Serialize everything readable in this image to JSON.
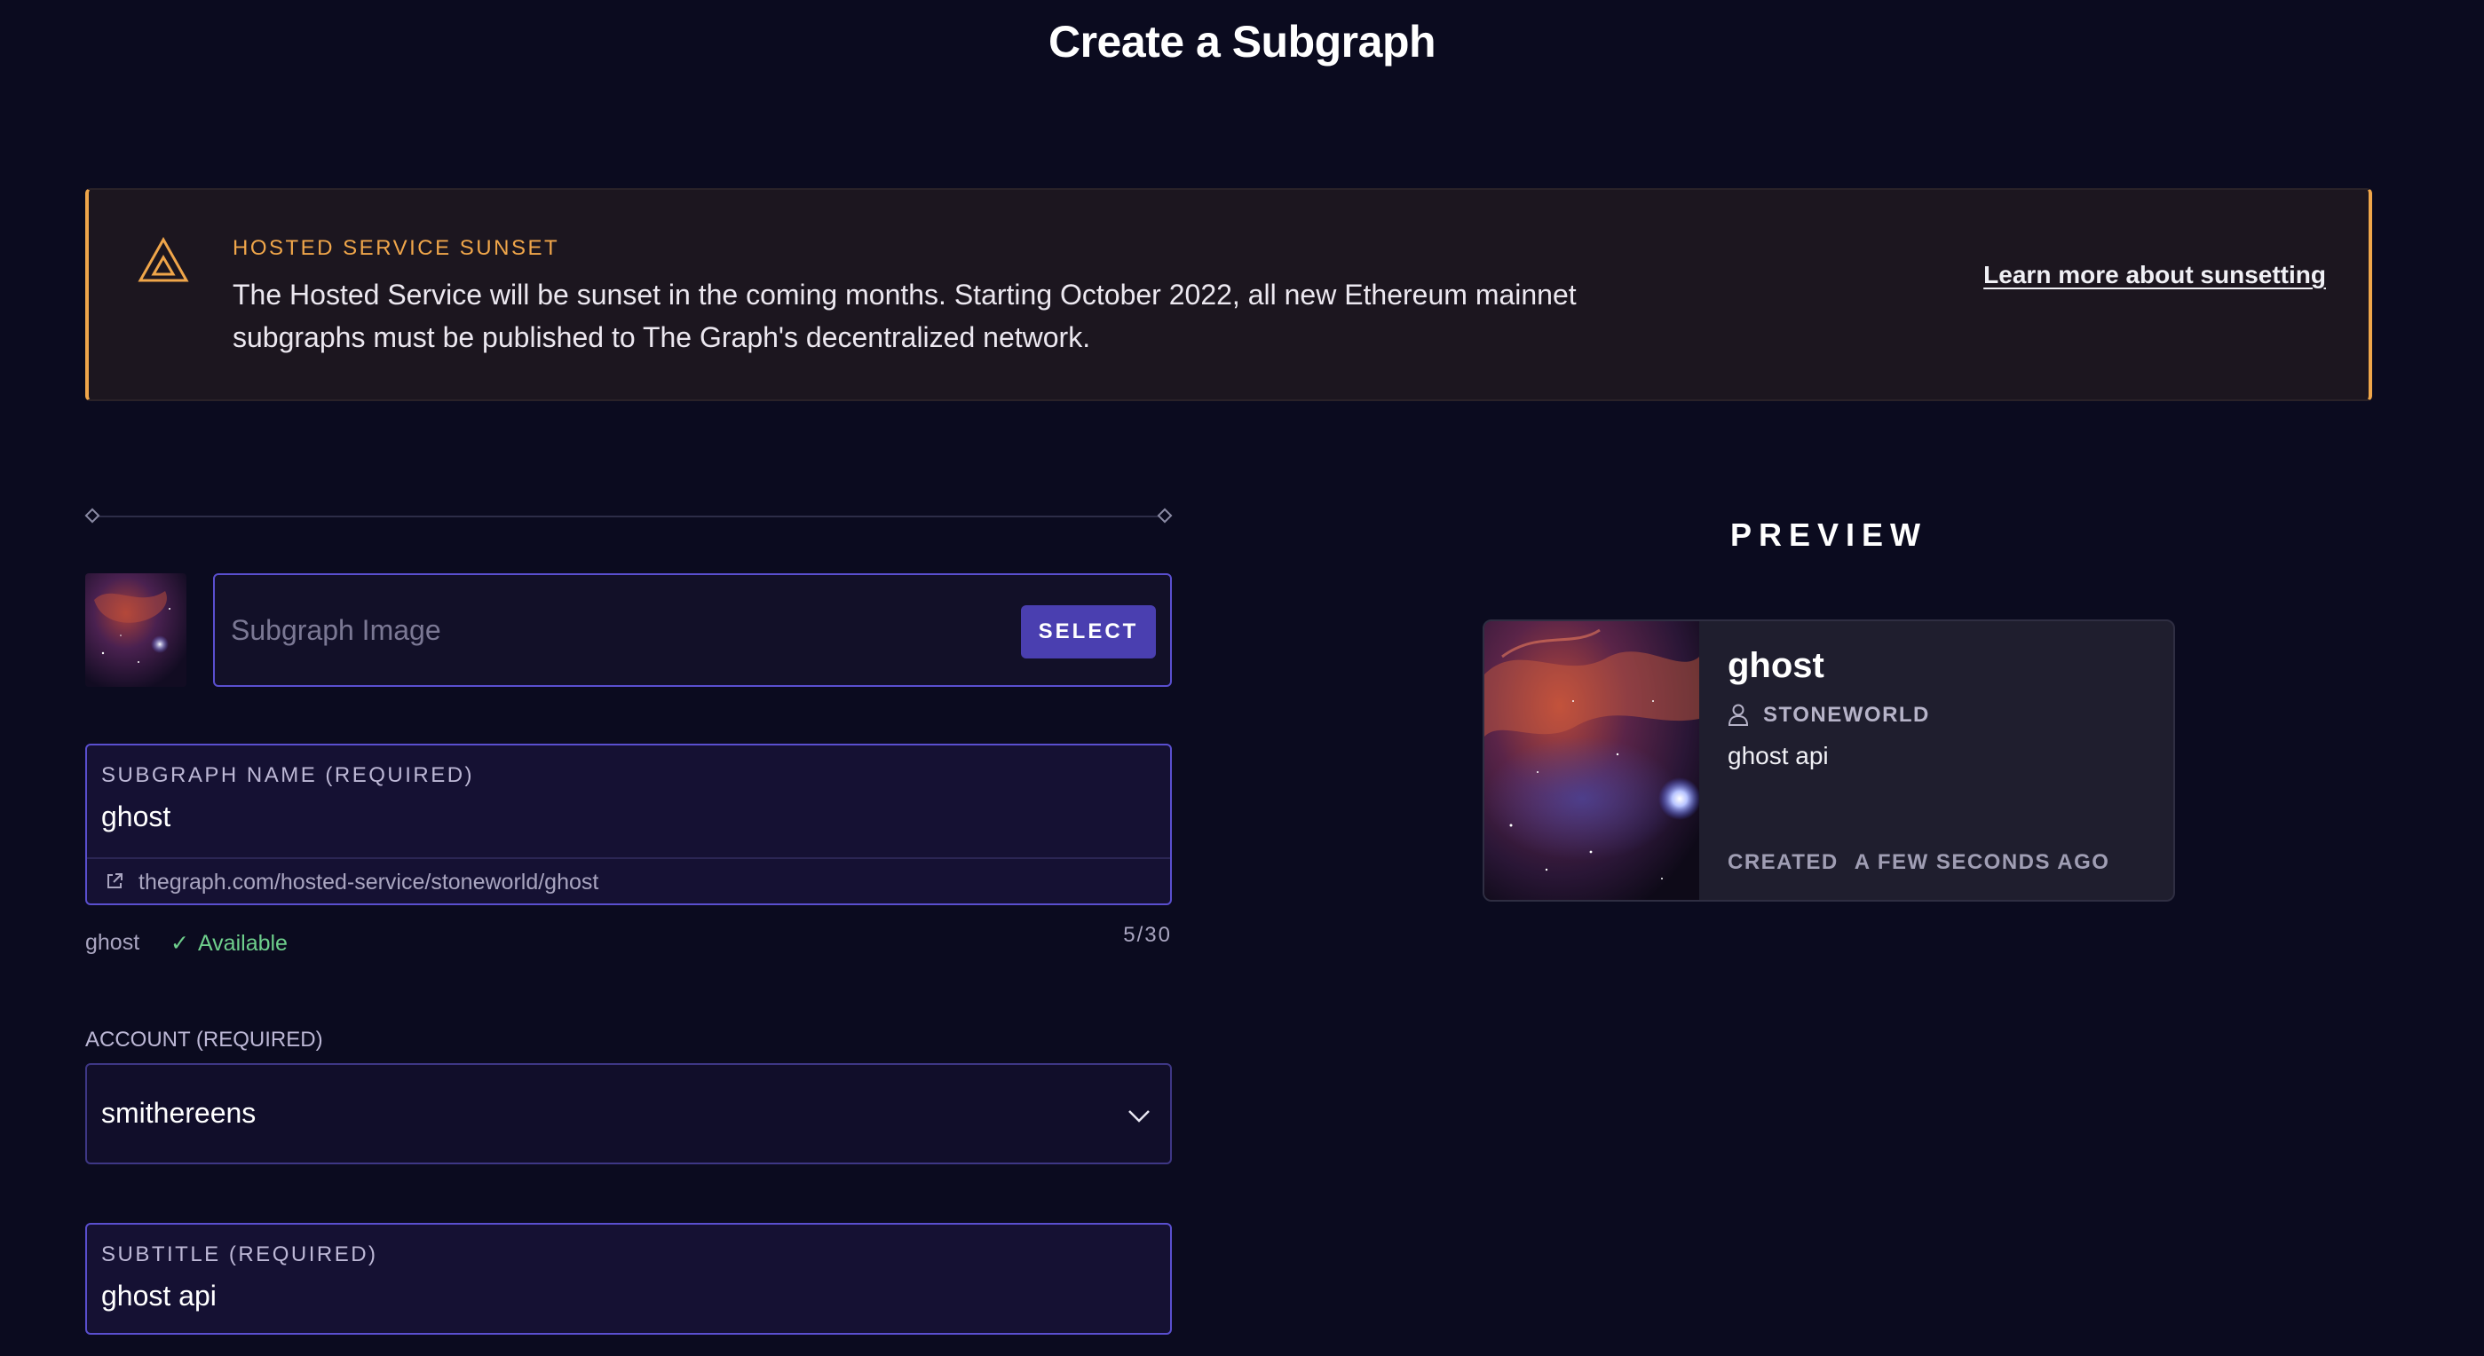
{
  "page": {
    "title": "Create a Subgraph"
  },
  "banner": {
    "heading": "HOSTED SERVICE SUNSET",
    "body": "The Hosted Service will be sunset in the coming months. Starting October 2022, all new Ethereum mainnet subgraphs must be published to The Graph's decentralized network.",
    "link_label": "Learn more about sunsetting",
    "icon": "warning-triangle-icon",
    "accent_color": "#f0a64a"
  },
  "form": {
    "image": {
      "placeholder": "Subgraph Image",
      "select_label": "SELECT"
    },
    "name": {
      "label": "SUBGRAPH NAME (REQUIRED)",
      "value": "ghost",
      "url": "thegraph.com/hosted-service/stoneworld/ghost",
      "echo": "ghost",
      "availability": "Available",
      "char_count": "5/30"
    },
    "account": {
      "label": "ACCOUNT (REQUIRED)",
      "value": "smithereens"
    },
    "subtitle": {
      "label": "SUBTITLE (REQUIRED)",
      "value": "ghost api"
    }
  },
  "preview": {
    "heading": "PREVIEW",
    "name": "ghost",
    "account": "STONEWORLD",
    "subtitle": "ghost api",
    "created_label": "CREATED",
    "created_value": "A FEW SECONDS AGO"
  },
  "colors": {
    "background": "#0b0b1f",
    "field_border": "#5a4fcf",
    "button": "#4a3fb0",
    "available": "#6ecf8c"
  }
}
